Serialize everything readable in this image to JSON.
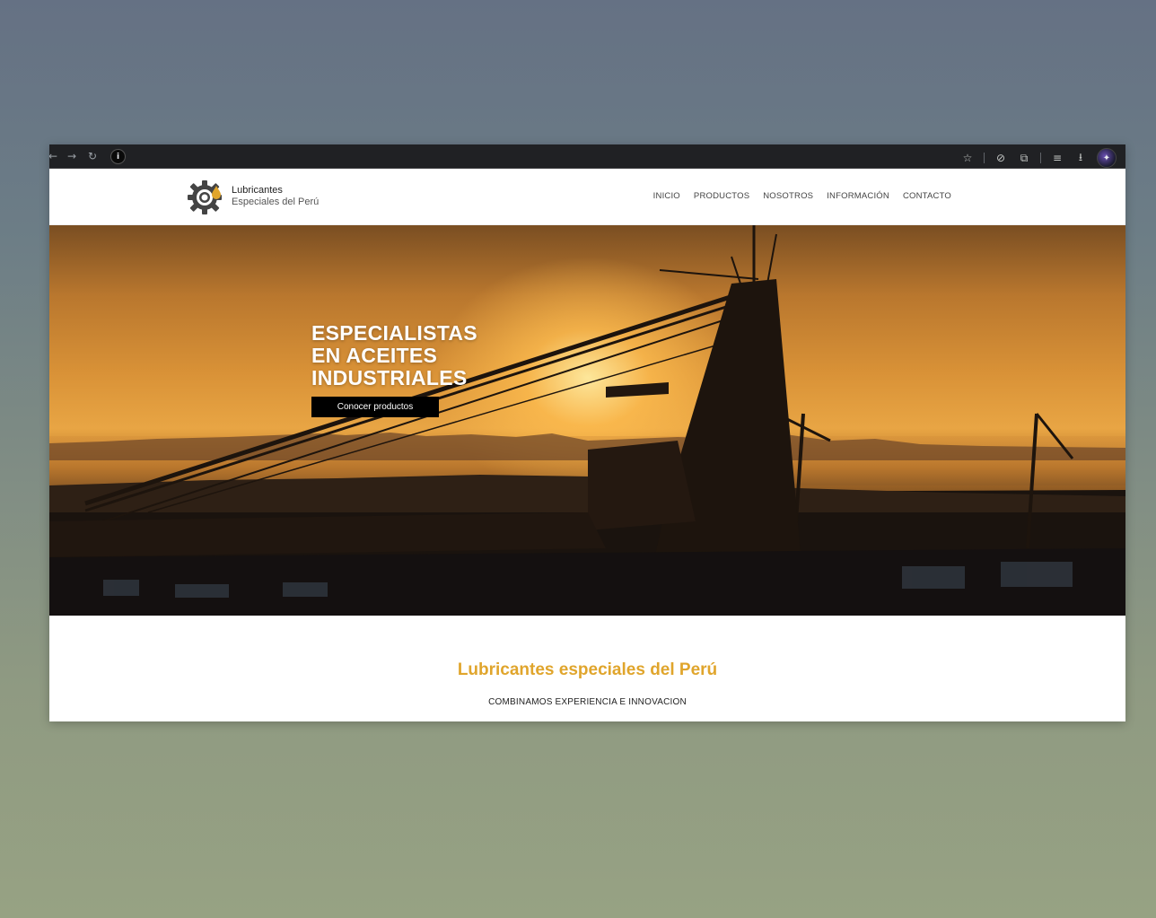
{
  "browser": {
    "back_glyph": "←",
    "forward_glyph": "→",
    "reload_glyph": "↻",
    "site_info_glyph": "i",
    "bookmark_glyph": "☆",
    "tools": [
      "⊘",
      "⧉",
      "≡",
      "⭳"
    ],
    "profile_glyph": "✦",
    "icons": [
      "back-arrow-icon",
      "forward-arrow-icon",
      "reload-icon",
      "site-info-icon",
      "bookmark-star-icon",
      "extension-icon",
      "puzzle-icon",
      "reading-list-icon",
      "download-icon",
      "profile-avatar"
    ]
  },
  "site": {
    "logo_line1": "Lubricantes",
    "logo_line2": "Especiales del Perú",
    "nav": [
      "INICIO",
      "PRODUCTOS",
      "NOSOTROS",
      "INFORMACIÓN",
      "CONTACTO"
    ]
  },
  "hero": {
    "title_line1": "ESPECIALISTAS",
    "title_line2": "EN ACEITES",
    "title_line3": "INDUSTRIALES",
    "button_label": "Conocer productos"
  },
  "intro": {
    "title": "Lubricantes especiales del Perú",
    "subtitle": "COMBINAMOS EXPERIENCIA E INNOVACION"
  },
  "colors": {
    "accent": "#e0a52c",
    "browser_bar": "#202124",
    "button_bg": "#000000"
  }
}
